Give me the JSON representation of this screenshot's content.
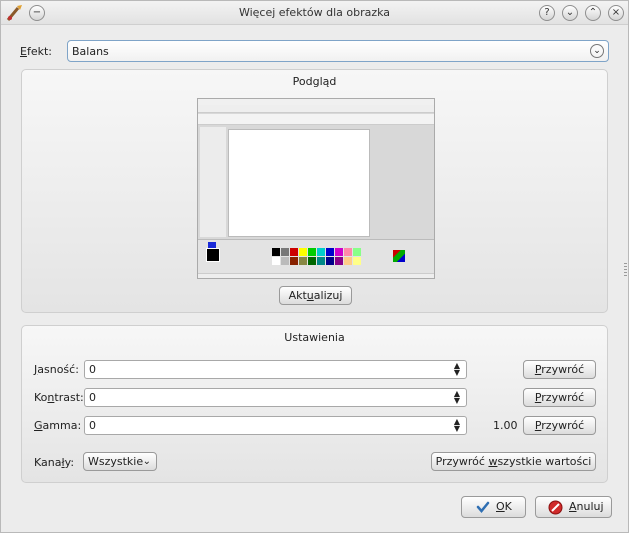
{
  "window": {
    "title": "Więcej efektów dla obrazka"
  },
  "effect": {
    "label_prefix": "",
    "label_u": "E",
    "label_rest": "fekt:",
    "value": "Balans"
  },
  "preview_panel": {
    "title": "Podgląd",
    "refresh_a": "Akt",
    "refresh_u": "u",
    "refresh_b": "alizuj"
  },
  "settings_panel": {
    "title": "Ustawienia",
    "brightness": {
      "label_u": "J",
      "label_rest": "asność:",
      "value": "0",
      "reset_u": "P",
      "reset_rest": "rzywróć"
    },
    "contrast": {
      "label_a": "Ko",
      "label_u": "n",
      "label_rest": "trast:",
      "value": "0",
      "reset_u": "P",
      "reset_rest": "rzywróć"
    },
    "gamma": {
      "label_u": "G",
      "label_rest": "amma:",
      "value": "0",
      "extra": "1.00",
      "reset_u": "P",
      "reset_rest": "rzywróć"
    },
    "channels": {
      "label_a": "Kana",
      "label_u": "ł",
      "label_rest": "y:",
      "value": "Wszystkie"
    },
    "reset_all": {
      "a": "Przywróć ",
      "u": "w",
      "b": "szystkie wartości"
    }
  },
  "buttons": {
    "ok_u": "O",
    "ok_rest": "K",
    "cancel_u": "A",
    "cancel_rest": "nuluj"
  },
  "colors": {
    "accent": "#7fa4c8",
    "ok_check": "#2f6fb3",
    "cancel_red": "#d02a2a"
  }
}
